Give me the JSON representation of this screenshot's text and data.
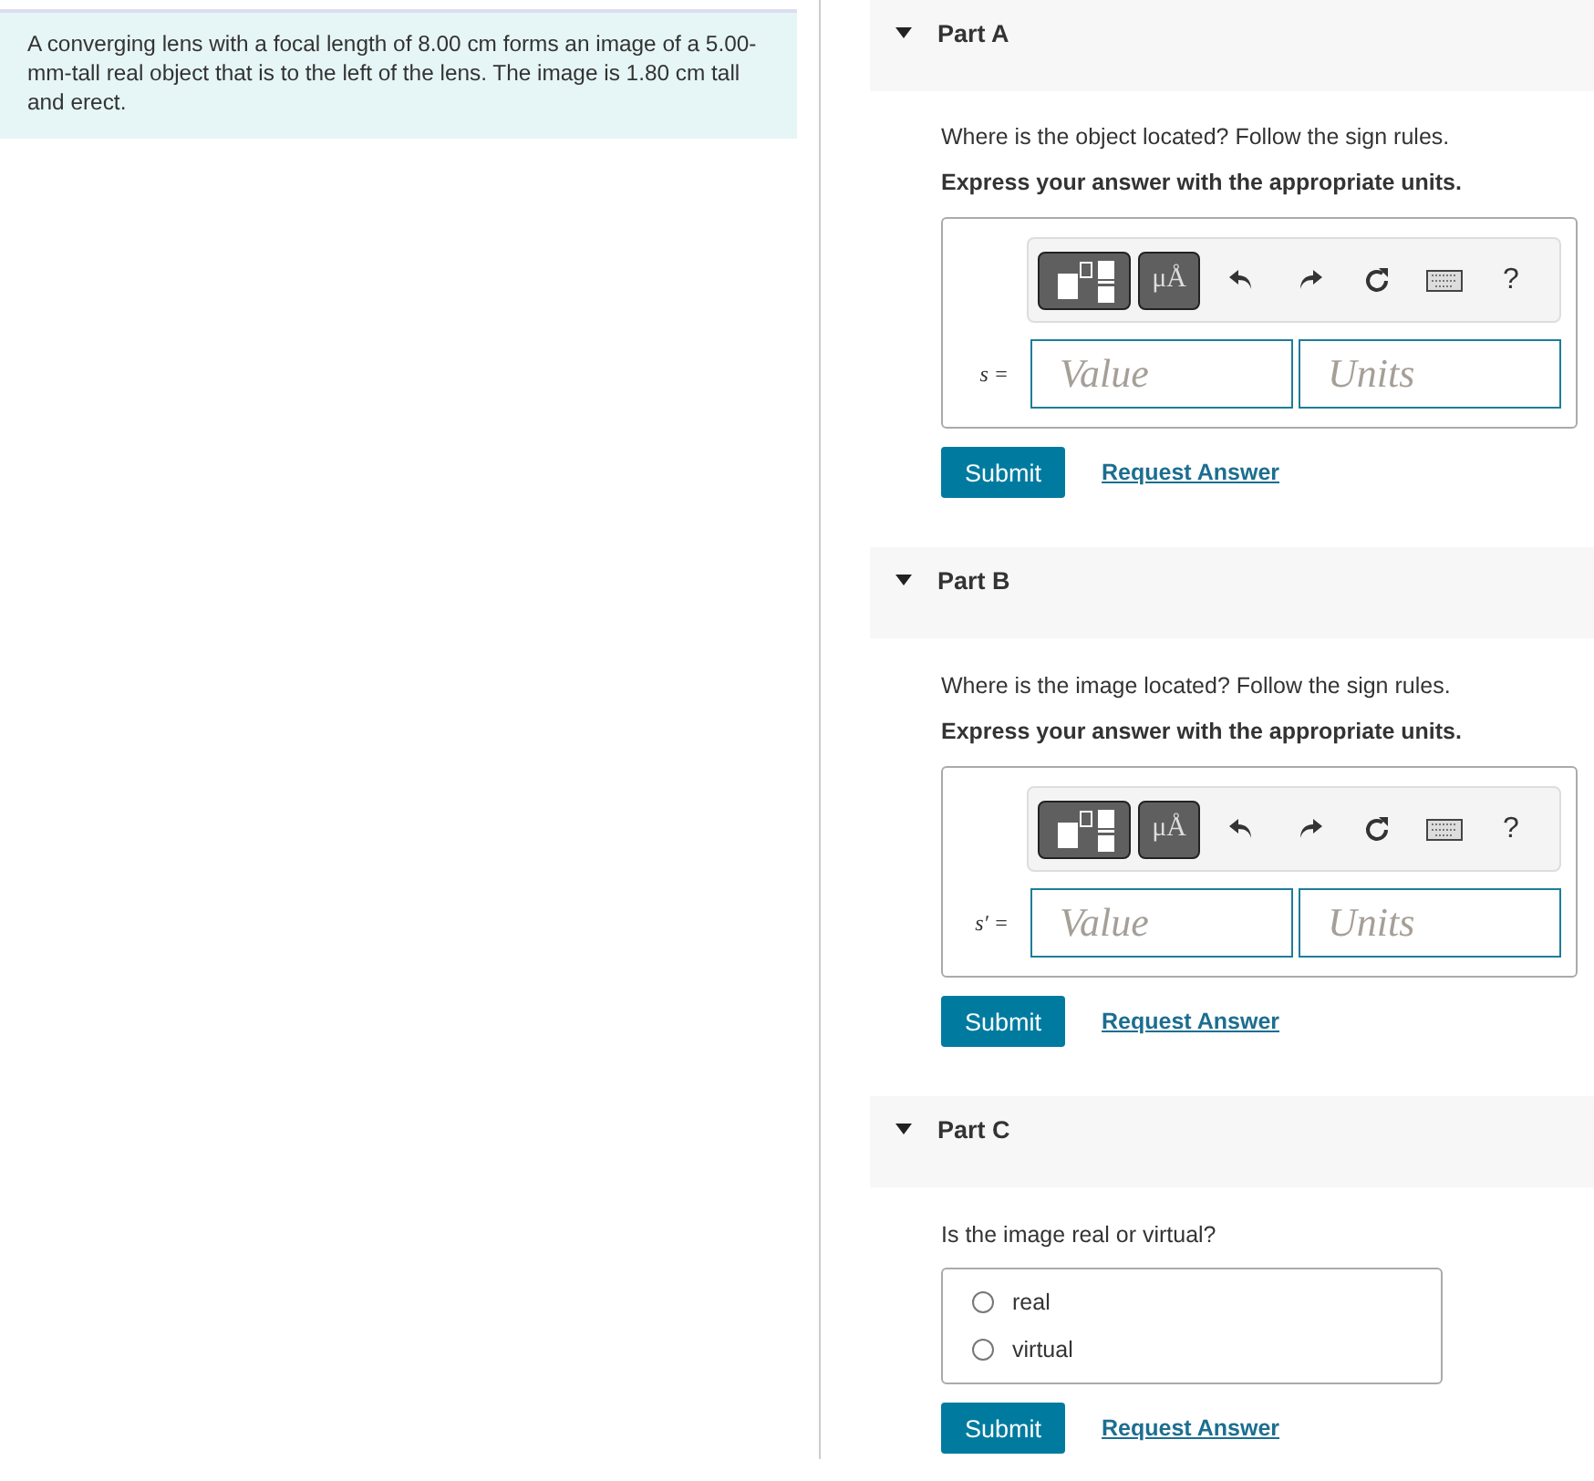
{
  "problem": {
    "text": "A converging lens with a focal length of 8.00 cm forms an image of a 5.00-mm-tall real object that is to the left of the lens. The image is 1.80 cm tall and erect."
  },
  "parts": [
    {
      "kind": "numeric",
      "title": "Part A",
      "expanded": true,
      "question": "Where is the object located? Follow the sign rules.",
      "instruction": "Express your answer with the appropriate units.",
      "toolbar": {
        "units_symbol": "μÅ",
        "help": "?"
      },
      "variable": "s =",
      "value_placeholder": "Value",
      "units_placeholder": "Units",
      "submit": "Submit",
      "request": "Request Answer"
    },
    {
      "kind": "numeric",
      "title": "Part B",
      "expanded": true,
      "question": "Where is the image located? Follow the sign rules.",
      "instruction": "Express your answer with the appropriate units.",
      "toolbar": {
        "units_symbol": "μÅ",
        "help": "?"
      },
      "variable": "s′ =",
      "value_placeholder": "Value",
      "units_placeholder": "Units",
      "submit": "Submit",
      "request": "Request Answer"
    },
    {
      "kind": "choice",
      "title": "Part C",
      "expanded": true,
      "question": "Is the image real or virtual?",
      "options": [
        {
          "label": "real",
          "selected": false
        },
        {
          "label": "virtual",
          "selected": false
        }
      ],
      "submit": "Submit",
      "request": "Request Answer"
    }
  ]
}
